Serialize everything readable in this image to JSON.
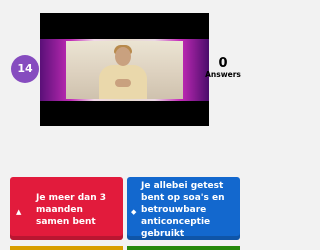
{
  "question": {
    "number": "14"
  },
  "answers_counter": {
    "count": "0",
    "label": "Answers"
  },
  "media": {
    "kind": "video",
    "subject": "person seated in a bright room with pink and purple light"
  },
  "answers": [
    {
      "label": "Je meer dan 3 maanden samen bent",
      "color": "#e21b3c",
      "shape": "triangle-icon"
    },
    {
      "label": "Je allebei getest bent op soa's en betrouwbare anticonceptie gebruikt",
      "color": "#1368ce",
      "shape": "diamond-icon"
    }
  ],
  "colors": {
    "question_number_badge": "#864cbf",
    "yellow_answer": "#d89e00",
    "green_answer": "#26890c"
  }
}
